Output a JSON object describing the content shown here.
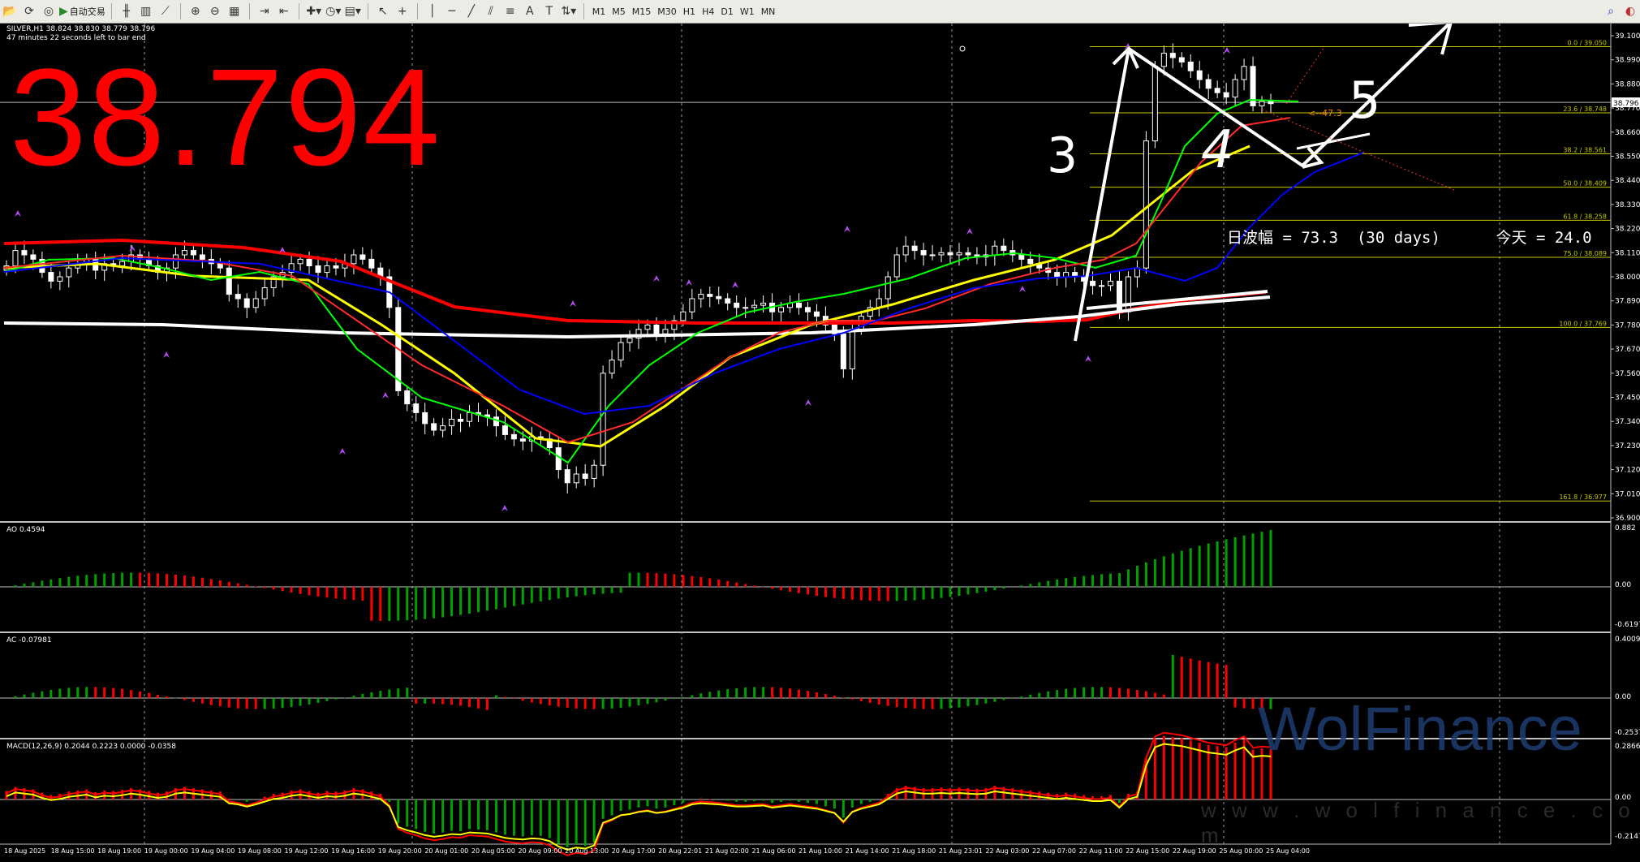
{
  "toolbar": {
    "auto_trade_label": "自动交易",
    "timeframes": [
      "M1",
      "M5",
      "M15",
      "M30",
      "H1",
      "H4",
      "D1",
      "W1",
      "MN"
    ]
  },
  "symbol": {
    "line1": "SILVER,H1  38.824 38.830 38.779 38.796",
    "line2": "47 minutes 22 seconds left to bar end"
  },
  "overlay_price": "38.794",
  "range_text": "日波幅 = 73.3  (30 days)      今天 = 24.0",
  "current_price_tag": "38.796",
  "price_axis": [
    "39.100",
    "38.990",
    "38.880",
    "38.770",
    "38.660",
    "38.550",
    "38.440",
    "38.330",
    "38.220",
    "38.110",
    "38.000",
    "37.890",
    "37.780",
    "37.670",
    "37.560",
    "37.450",
    "37.340",
    "37.230",
    "37.120",
    "37.010",
    "36.900"
  ],
  "fib_levels": [
    {
      "label": "0.0 / 39.050"
    },
    {
      "label": "23.6 / 38.748"
    },
    {
      "label": "38.2 / 38.561"
    },
    {
      "label": "50.0 / 38.409"
    },
    {
      "label": "61.8 / 38.258"
    },
    {
      "label": "75.0 / 38.089"
    },
    {
      "label": "100.0 / 37.769"
    },
    {
      "label": "161.8 / 36.977"
    }
  ],
  "wave_labels": [
    "3",
    "4",
    "5"
  ],
  "arrow_note": "<--47.3",
  "time_axis": [
    "18 Aug 2025",
    "18 Aug 15:00",
    "18 Aug 19:00",
    "19 Aug 00:00",
    "19 Aug 04:00",
    "19 Aug 08:00",
    "19 Aug 12:00",
    "19 Aug 16:00",
    "19 Aug 20:00",
    "20 Aug 01:00",
    "20 Aug 05:00",
    "20 Aug 09:00",
    "20 Aug 13:00",
    "20 Aug 17:00",
    "20 Aug 22:01",
    "21 Aug 02:00",
    "21 Aug 06:00",
    "21 Aug 10:00",
    "21 Aug 14:00",
    "21 Aug 18:00",
    "21 Aug 23:01",
    "22 Aug 03:00",
    "22 Aug 07:00",
    "22 Aug 11:00",
    "22 Aug 15:00",
    "22 Aug 19:00",
    "25 Aug 00:00",
    "25 Aug 04:00"
  ],
  "indicators": {
    "ao": {
      "label": "AO 0.4594",
      "axis": [
        "0.882",
        "0.00",
        "-0.6197"
      ]
    },
    "ac": {
      "label": "AC -0.07981",
      "axis": [
        "0.40093",
        "0.00",
        "-0.25374"
      ]
    },
    "macd": {
      "label": "MACD(12,26,9) 0.2044 0.2223 0.0000 -0.0358",
      "axis": [
        "0.2866",
        "0.00",
        "-0.2147"
      ]
    }
  },
  "watermark": {
    "brand": "WolFinance",
    "url": "w w w . w o l f i n a n c e . c o m"
  },
  "colors": {
    "up": "#00a000",
    "down": "#ff0000",
    "ma_red": "#ff0000",
    "ma_white": "#ffffff",
    "ma_yellow": "#ffff00",
    "ma_green": "#00ff00",
    "ma_blue": "#0000ff",
    "fib": "#c8c800"
  }
}
